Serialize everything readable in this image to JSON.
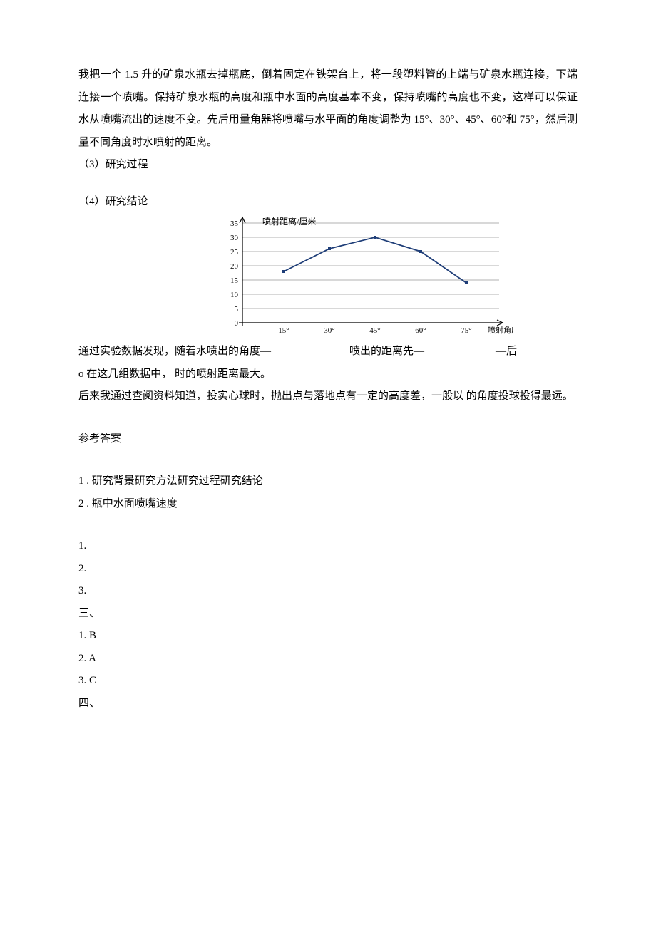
{
  "paragraphs": {
    "intro": "我把一个 1.5 升的矿泉水瓶去掉瓶底，倒着固定在铁架台上，将一段塑料管的上端与矿泉水瓶连接，下端连接一个喷嘴。保持矿泉水瓶的高度和瓶中水面的高度基本不变，保持喷嘴的高度也不变，这样可以保证水从喷嘴流出的速度不变。先后用量角器将喷嘴与水平面的角度调整为 15°、30°、45°、60°和 75°，然后测量不同角度时水喷射的距离。",
    "section3": "（3）研究过程",
    "section4": "（4）研究结论",
    "finding_prefix": "通过实验数据发现，随着水喷出的角度—",
    "finding_mid": "喷出的距离先—",
    "finding_suffix": "—后",
    "finding_line2": "o 在这几组数据中， 时的喷射距离最大。",
    "followup": "后来我通过查阅资料知道，投实心球时，抛出点与落地点有一定的高度差，一般以 的角度投球投得最远。",
    "answers_heading": "参考答案",
    "ans1": "1 . 研究背景研究方法研究过程研究结论",
    "ans2": "2 . 瓶中水面喷嘴速度",
    "blank_list": [
      "1.",
      "2.",
      "3."
    ],
    "section_three_head": "三、",
    "section_three_items": [
      "1. B",
      "2. A",
      "3. C"
    ],
    "section_four_head": "四、"
  },
  "chart_data": {
    "type": "line",
    "title": "",
    "ylabel": "喷射距离/厘米",
    "xlabel": "喷射角度",
    "categories": [
      "15°",
      "30°",
      "45°",
      "60°",
      "75°"
    ],
    "values": [
      18,
      26,
      30,
      25,
      14
    ],
    "ylim": [
      0,
      35
    ],
    "y_ticks": [
      0,
      5,
      10,
      15,
      20,
      25,
      30,
      35
    ],
    "grid": true
  }
}
